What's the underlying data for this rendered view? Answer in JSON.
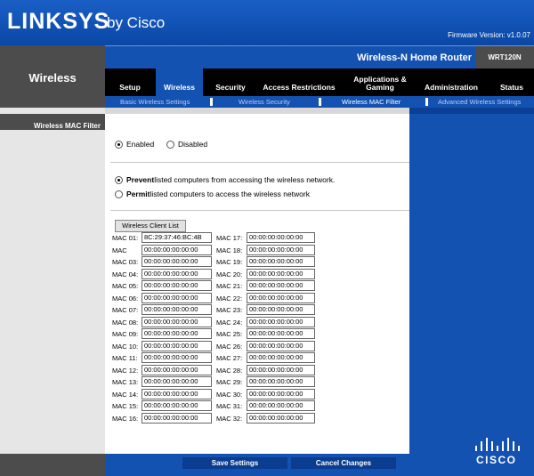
{
  "header": {
    "brand": "LINKSYS",
    "by": "by Cisco",
    "firmware": "Firmware Version: v1.0.07",
    "product_name": "Wireless-N Home Router",
    "model": "WRT120N"
  },
  "section": {
    "title": "Wireless",
    "left_label": "Wireless MAC Filter"
  },
  "tabs": [
    {
      "label": "Setup",
      "active": false
    },
    {
      "label": "Wireless",
      "active": true
    },
    {
      "label": "Security",
      "active": false
    },
    {
      "label": "Access Restrictions",
      "active": false
    },
    {
      "label": "Applications & Gaming",
      "active": false
    },
    {
      "label": "Administration",
      "active": false
    },
    {
      "label": "Status",
      "active": false
    }
  ],
  "subtabs": [
    {
      "label": "Basic Wireless Settings",
      "active": false
    },
    {
      "label": "Wireless Security",
      "active": false
    },
    {
      "label": "Wireless MAC Filter",
      "active": true
    },
    {
      "label": "Advanced Wireless Settings",
      "active": false
    }
  ],
  "filter": {
    "enabled_label": "Enabled",
    "disabled_label": "Disabled",
    "enabled": true,
    "prevent_bold": "Prevent",
    "prevent_rest": " listed computers from accessing the wireless network.",
    "permit_bold": "Permit",
    "permit_rest": " listed computers to access the wireless network",
    "mode": "prevent"
  },
  "client_list_button": "Wireless Client List",
  "mac_left": [
    {
      "label": "MAC 01:",
      "value": "8C:29:37:46:BC:4B"
    },
    {
      "label": "MAC",
      "value": "00:00:00:00:00:00"
    },
    {
      "label": "MAC 03:",
      "value": "00:00:00:00:00:00"
    },
    {
      "label": "MAC 04:",
      "value": "00:00:00:00:00:00"
    },
    {
      "label": "MAC 05:",
      "value": "00:00:00:00:00:00"
    },
    {
      "label": "MAC 06:",
      "value": "00:00:00:00:00:00"
    },
    {
      "label": "MAC 07:",
      "value": "00:00:00:00:00:00"
    },
    {
      "label": "MAC 08:",
      "value": "00:00:00:00:00:00"
    },
    {
      "label": "MAC 09:",
      "value": "00:00:00:00:00:00"
    },
    {
      "label": "MAC 10:",
      "value": "00:00:00:00:00:00"
    },
    {
      "label": "MAC 11:",
      "value": "00:00:00:00:00:00"
    },
    {
      "label": "MAC 12:",
      "value": "00:00:00:00:00:00"
    },
    {
      "label": "MAC 13:",
      "value": "00:00:00:00:00:00"
    },
    {
      "label": "MAC 14:",
      "value": "00:00:00:00:00:00"
    },
    {
      "label": "MAC 15:",
      "value": "00:00:00:00:00:00"
    },
    {
      "label": "MAC 16:",
      "value": "00:00:00:00:00:00"
    }
  ],
  "mac_right": [
    {
      "label": "MAC 17:",
      "value": "00:00:00:00:00:00"
    },
    {
      "label": "MAC 18:",
      "value": "00:00:00:00:00:00"
    },
    {
      "label": "MAC 19:",
      "value": "00:00:00:00:00:00"
    },
    {
      "label": "MAC 20:",
      "value": "00:00:00:00:00:00"
    },
    {
      "label": "MAC 21:",
      "value": "00:00:00:00:00:00"
    },
    {
      "label": "MAC 22:",
      "value": "00:00:00:00:00:00"
    },
    {
      "label": "MAC 23:",
      "value": "00:00:00:00:00:00"
    },
    {
      "label": "MAC 24:",
      "value": "00:00:00:00:00:00"
    },
    {
      "label": "MAC 25:",
      "value": "00:00:00:00:00:00"
    },
    {
      "label": "MAC 26:",
      "value": "00:00:00:00:00:00"
    },
    {
      "label": "MAC 27:",
      "value": "00:00:00:00:00:00"
    },
    {
      "label": "MAC 28:",
      "value": "00:00:00:00:00:00"
    },
    {
      "label": "MAC 29:",
      "value": "00:00:00:00:00:00"
    },
    {
      "label": "MAC 30:",
      "value": "00:00:00:00:00:00"
    },
    {
      "label": "MAC 31:",
      "value": "00:00:00:00:00:00"
    },
    {
      "label": "MAC 32:",
      "value": "00:00:00:00:00:00"
    }
  ],
  "footer": {
    "save": "Save Settings",
    "cancel": "Cancel Changes",
    "cisco": "CISCO"
  }
}
